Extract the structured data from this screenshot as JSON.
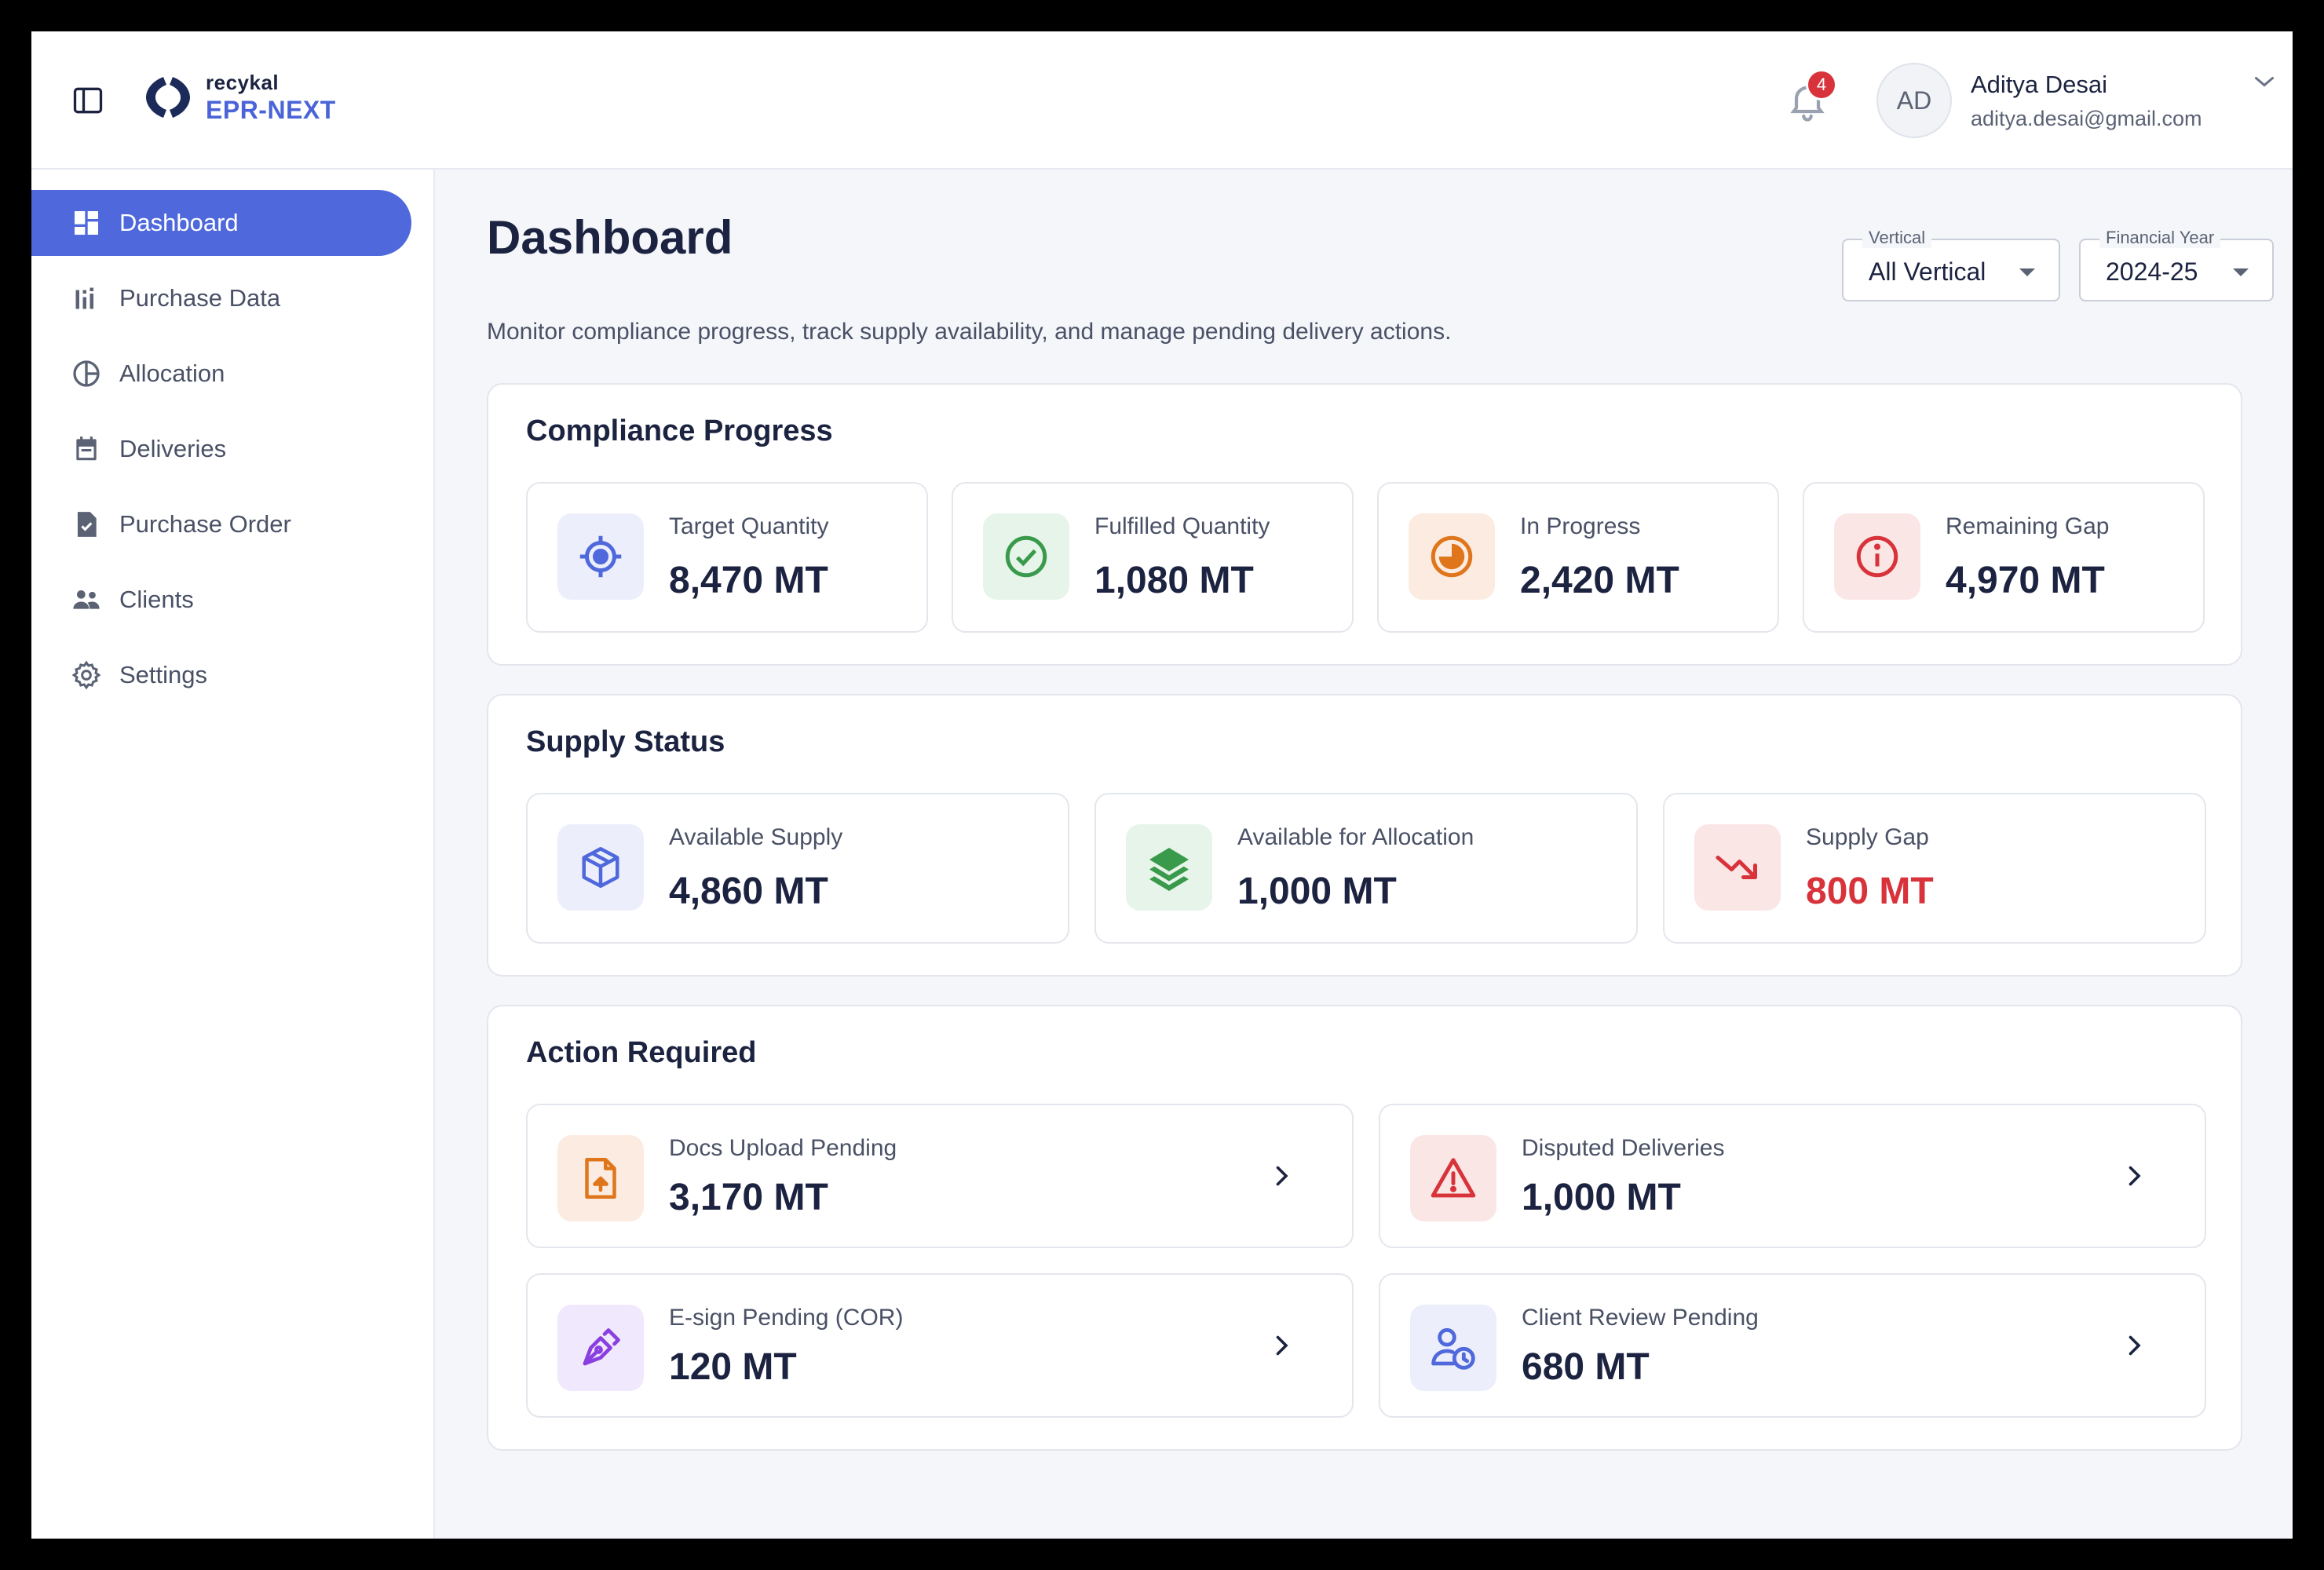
{
  "brand": {
    "company": "recykal",
    "product": "EPR-NEXT"
  },
  "header": {
    "notification_count": "4",
    "user": {
      "initials": "AD",
      "name": "Aditya Desai",
      "email": "aditya.desai@gmail.com"
    }
  },
  "sidebar": {
    "items": [
      {
        "label": "Dashboard",
        "icon": "dashboard-icon",
        "active": true
      },
      {
        "label": "Purchase Data",
        "icon": "bar-chart-icon"
      },
      {
        "label": "Allocation",
        "icon": "pie-chart-icon"
      },
      {
        "label": "Deliveries",
        "icon": "calendar-icon"
      },
      {
        "label": "Purchase Order",
        "icon": "document-check-icon"
      },
      {
        "label": "Clients",
        "icon": "people-icon"
      },
      {
        "label": "Settings",
        "icon": "gear-icon"
      }
    ]
  },
  "page": {
    "title": "Dashboard",
    "subtitle": "Monitor compliance progress, track supply availability, and manage pending delivery actions."
  },
  "filters": {
    "vertical": {
      "label": "Vertical",
      "value": "All Vertical"
    },
    "year": {
      "label": "Financial Year",
      "value": "2024-25"
    }
  },
  "compliance": {
    "title": "Compliance Progress",
    "cards": [
      {
        "label": "Target Quantity",
        "value": "8,470 MT",
        "icon": "target-icon"
      },
      {
        "label": "Fulfilled Quantity",
        "value": "1,080 MT",
        "icon": "check-circle-icon"
      },
      {
        "label": "In Progress",
        "value": "2,420 MT",
        "icon": "progress-icon"
      },
      {
        "label": "Remaining Gap",
        "value": "4,970 MT",
        "icon": "info-icon"
      }
    ]
  },
  "supply": {
    "title": "Supply Status",
    "cards": [
      {
        "label": "Available Supply",
        "value": "4,860 MT",
        "icon": "box-icon"
      },
      {
        "label": "Available for Allocation",
        "value": "1,000 MT",
        "icon": "layers-icon"
      },
      {
        "label": "Supply Gap",
        "value": "800 MT",
        "icon": "trending-down-icon"
      }
    ]
  },
  "actions": {
    "title": "Action Required",
    "cards": [
      {
        "label": "Docs Upload Pending",
        "value": "3,170 MT",
        "icon": "file-upload-icon"
      },
      {
        "label": "Disputed Deliveries",
        "value": "1,000 MT",
        "icon": "warning-icon"
      },
      {
        "label": "E-sign Pending (COR)",
        "value": "120 MT",
        "icon": "pen-icon"
      },
      {
        "label": "Client Review Pending",
        "value": "680 MT",
        "icon": "user-clock-icon"
      }
    ]
  },
  "colors": {
    "accent": "#4f68dc",
    "danger": "#d8333a",
    "success": "#3a9a4c",
    "warning": "#e0761c",
    "purple": "#8a3fe0"
  }
}
